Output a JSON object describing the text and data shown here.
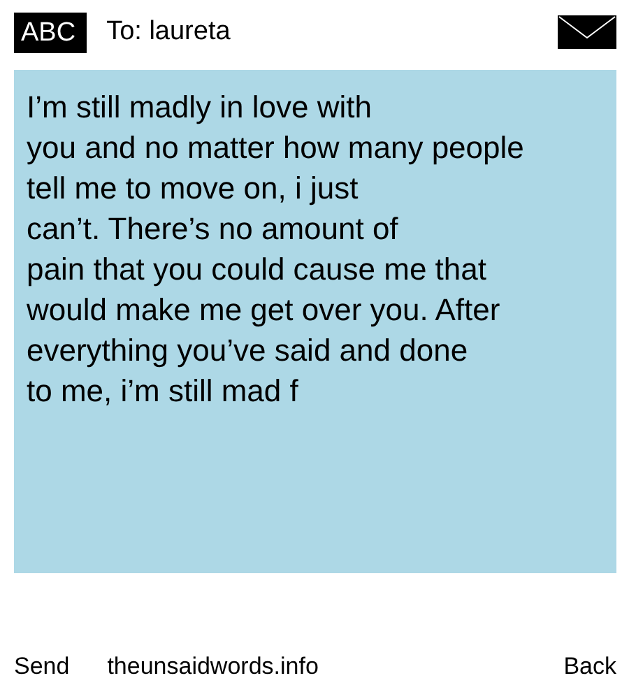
{
  "header": {
    "mode_badge": "ABC",
    "recipient": "To: laureta"
  },
  "message": {
    "lines": [
      "I’m still madly in love with",
      "you and no matter how many people",
      "tell me to move on, i just",
      "can’t. There’s no amount of",
      "pain that you could cause me that",
      "would make me get over you. After",
      "everything you’ve said and done",
      "to me, i’m still mad f"
    ]
  },
  "footer": {
    "left": "Send",
    "center": "theunsaidwords.info",
    "right": "Back"
  }
}
